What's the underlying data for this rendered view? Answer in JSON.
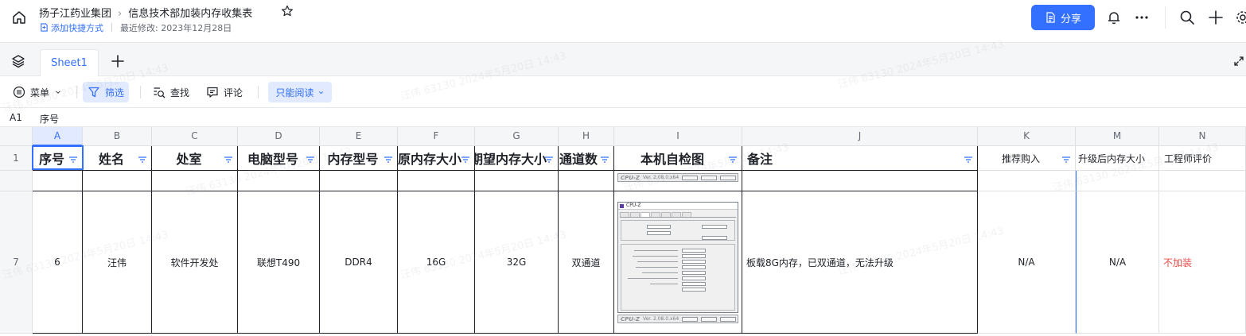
{
  "header": {
    "breadcrumb_parent": "扬子江药业集团",
    "doc_title": "信息技术部加装内存收集表",
    "add_shortcut": "添加快捷方式",
    "last_modified": "最近修改: 2023年12月28日",
    "share_label": "分享"
  },
  "sheets": {
    "tabs": [
      "Sheet1"
    ]
  },
  "toolbar": {
    "menu_label": "菜单",
    "filter_label": "筛选",
    "find_label": "查找",
    "comment_label": "评论",
    "readonly_label": "只能阅读"
  },
  "formula_bar": {
    "cell_ref": "A1",
    "value": "序号"
  },
  "grid": {
    "columns": [
      "A",
      "B",
      "C",
      "D",
      "E",
      "F",
      "G",
      "H",
      "I",
      "J",
      "K",
      "M",
      "N"
    ],
    "row_numbers": [
      "1",
      "7"
    ],
    "header_row": [
      "序号",
      "姓名",
      "处室",
      "电脑型号",
      "内存型号",
      "原内存大小",
      "期望内存大小",
      "通道数",
      "本机自检图",
      "备注",
      "推荐购入",
      "升级后内存大小",
      "工程师评价"
    ],
    "row7": [
      "6",
      "汪伟",
      "软件开发处",
      "联想T490",
      "DDR4",
      "16G",
      "32G",
      "双通道",
      "",
      "板载8G内存，已双通道，无法升级",
      "N/A",
      "N/A",
      "不加装"
    ]
  },
  "cpuz": {
    "logo": "CPU-Z",
    "version": "Ver. 2.08.0.x64",
    "window_title": "CPU-Z"
  },
  "watermark": "汪伟 63130 2024年5月20日 14:43",
  "colors": {
    "accent": "#3370ff",
    "danger": "#f54a45"
  }
}
